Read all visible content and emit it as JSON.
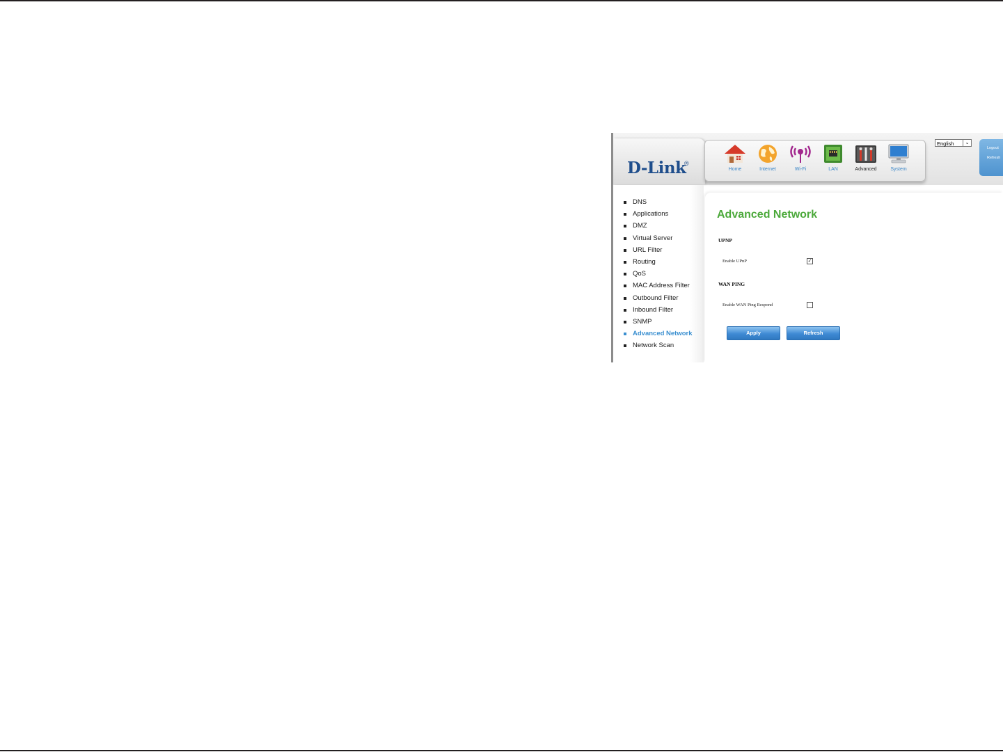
{
  "brand": {
    "logo": "D-Link",
    "mark": "®"
  },
  "nav": {
    "items": [
      {
        "label": "Home",
        "icon": "home-icon",
        "active": false
      },
      {
        "label": "Internet",
        "icon": "internet-globe-icon",
        "active": false
      },
      {
        "label": "Wi-Fi",
        "icon": "wifi-icon",
        "active": false
      },
      {
        "label": "LAN",
        "icon": "lan-icon",
        "active": false
      },
      {
        "label": "Advanced",
        "icon": "advanced-tools-icon",
        "active": true
      },
      {
        "label": "System",
        "icon": "system-monitor-icon",
        "active": false
      }
    ]
  },
  "language": {
    "selected": "English"
  },
  "side_tab": {
    "logout": "Logout",
    "refresh": "Refresh"
  },
  "menu": {
    "items": [
      {
        "label": "DNS"
      },
      {
        "label": "Applications"
      },
      {
        "label": "DMZ"
      },
      {
        "label": "Virtual Server"
      },
      {
        "label": "URL Filter"
      },
      {
        "label": "Routing"
      },
      {
        "label": "QoS"
      },
      {
        "label": "MAC Address Filter"
      },
      {
        "label": "Outbound Filter"
      },
      {
        "label": "Inbound Filter"
      },
      {
        "label": "SNMP"
      },
      {
        "label": "Advanced Network",
        "active": true
      },
      {
        "label": "Network Scan"
      }
    ]
  },
  "main": {
    "title": "Advanced Network",
    "upnp_section": "UPNP",
    "enable_upnp_label": "Enable UPnP",
    "enable_upnp_checked": true,
    "wan_ping_section": "WAN PING",
    "wan_ping_label": "Enable WAN Ping Respond",
    "wan_ping_checked": false,
    "apply_label": "Apply",
    "refresh_label": "Refresh"
  },
  "colors": {
    "title_green": "#4ca93b",
    "link_blue": "#3a86c8",
    "brand_blue": "#1f4e8c"
  }
}
